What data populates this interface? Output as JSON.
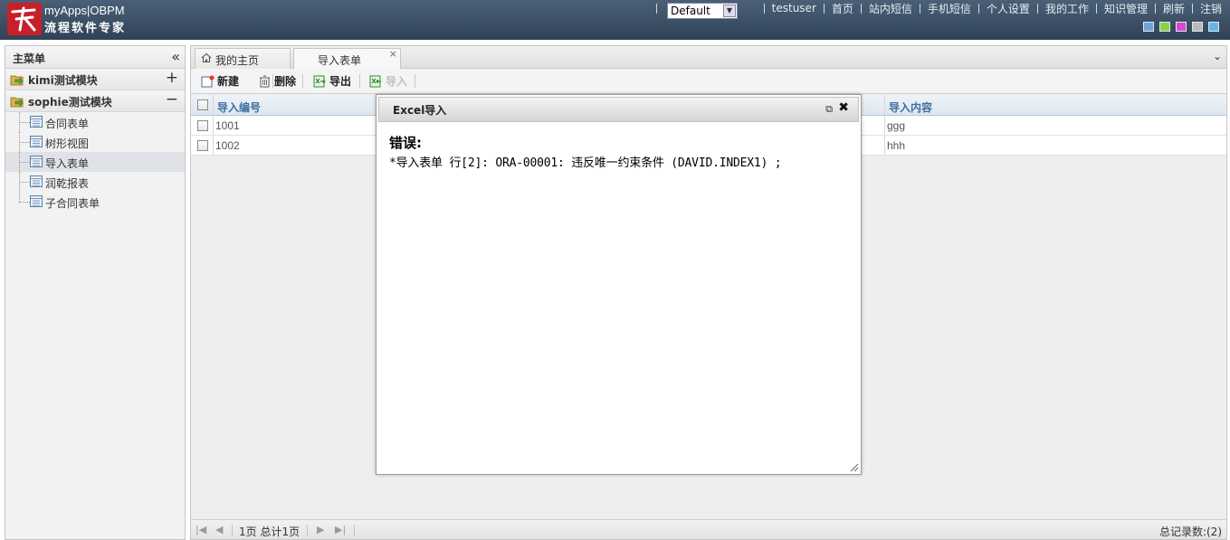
{
  "header": {
    "brand_line1": "myApps|OBPM",
    "brand_line2": "流程软件专家",
    "theme_selected": "Default",
    "nav": [
      "testuser",
      "首页",
      "站内短信",
      "手机短信",
      "个人设置",
      "我的工作",
      "知识管理",
      "刷新",
      "注销"
    ],
    "swatch_colors": [
      "#6fa3d8",
      "#8bd14a",
      "#d94ad1",
      "#b8b8b8",
      "#63b8e6"
    ]
  },
  "sidebar": {
    "title": "主菜单",
    "modules": [
      {
        "label": "kimi测试模块",
        "toggle": "+"
      },
      {
        "label": "sophie测试模块",
        "toggle": "−"
      }
    ],
    "items": [
      {
        "label": "合同表单"
      },
      {
        "label": "树形视图"
      },
      {
        "label": "导入表单"
      },
      {
        "label": "润乾报表"
      },
      {
        "label": "子合同表单"
      }
    ]
  },
  "tabs": {
    "home_label": "我的主页",
    "active_label": "导入表单",
    "close_symbol": "×"
  },
  "toolbar": {
    "new_label": "新建",
    "delete_label": "删除",
    "export_label": "导出",
    "import_label": "导入"
  },
  "grid": {
    "columns": [
      "导入编号",
      "导入内容"
    ],
    "rows": [
      {
        "id": "1001",
        "content": "ggg"
      },
      {
        "id": "1002",
        "content": "hhh"
      }
    ]
  },
  "pager": {
    "page_text": "1页 总计1页",
    "total_text": "总记录数:(2)"
  },
  "dialog": {
    "title": "Excel导入",
    "error_title": "错误:",
    "error_message": "*导入表单 行[2]: ORA-00001: 违反唯一约束条件 (DAVID.INDEX1) ;"
  }
}
